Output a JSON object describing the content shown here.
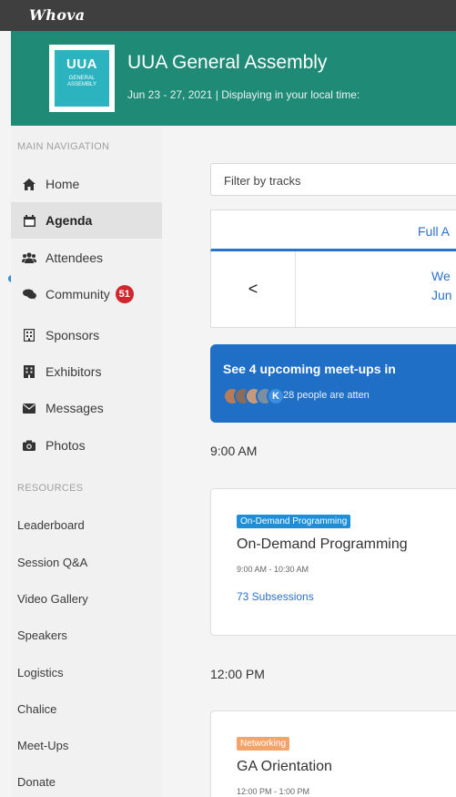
{
  "app": {
    "brand": "Whova"
  },
  "event": {
    "logo_text": "UUA",
    "logo_subtext": "GENERAL ASSEMBLY",
    "title": "UUA General Assembly",
    "dates": "Jun 23 - 27, 2021   |   Displaying in your local time:"
  },
  "sidebar": {
    "main_heading": "MAIN NAVIGATION",
    "items": [
      {
        "label": "Home",
        "icon": "home-icon"
      },
      {
        "label": "Agenda",
        "icon": "calendar-icon"
      },
      {
        "label": "Attendees",
        "icon": "people-icon"
      },
      {
        "label": "Community",
        "icon": "chat-icon",
        "badge": "51"
      },
      {
        "label": "Sponsors",
        "icon": "sponsor-icon"
      },
      {
        "label": "Exhibitors",
        "icon": "exhibitor-icon"
      },
      {
        "label": "Messages",
        "icon": "envelope-icon"
      },
      {
        "label": "Photos",
        "icon": "camera-icon"
      }
    ],
    "resources_heading": "RESOURCES",
    "resources": [
      "Leaderboard",
      "Session Q&A",
      "Video Gallery",
      "Speakers",
      "Logistics",
      "Chalice",
      "Meet-Ups",
      "Donate"
    ]
  },
  "main": {
    "filter_placeholder": "Filter by tracks",
    "tab_active": "Full A",
    "prev_symbol": "<",
    "day_line1": "We",
    "day_line2": "Jun",
    "banner": {
      "title": "See 4 upcoming meet-ups in",
      "avatar_letter": "K",
      "attending": "28 people are atten"
    },
    "sessions": [
      {
        "time_heading": "9:00 AM",
        "tag": "On-Demand Programming",
        "title": "On-Demand Programming",
        "time": "9:00 AM - 10:30 AM",
        "link": "73 Subsessions"
      },
      {
        "time_heading": "12:00 PM",
        "tag": "Networking",
        "title": "GA Orientation",
        "time": "12:00 PM - 1:00 PM"
      }
    ]
  },
  "colors": {
    "header_teal": "#1f8a76",
    "top_bar": "#3f3f3f",
    "accent_blue": "#2a72c9",
    "badge_red": "#d0262d",
    "tag_blue": "#1e8fd6",
    "tag_orange": "#f3a46b"
  }
}
